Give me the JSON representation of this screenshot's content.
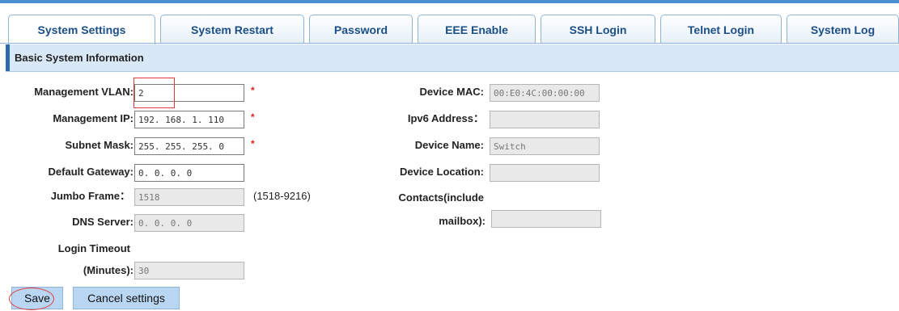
{
  "tabs": [
    {
      "label": "System Settings"
    },
    {
      "label": "System Restart"
    },
    {
      "label": "Password"
    },
    {
      "label": "EEE Enable"
    },
    {
      "label": "SSH Login"
    },
    {
      "label": "Telnet Login"
    },
    {
      "label": "System Log"
    }
  ],
  "section": {
    "title": "Basic System Information"
  },
  "left_fields": {
    "mgmt_vlan": {
      "label": "Management VLAN:",
      "value": "2",
      "required": "*"
    },
    "mgmt_ip": {
      "label": "Management IP:",
      "value": "192. 168. 1. 110",
      "required": "*"
    },
    "subnet": {
      "label": "Subnet Mask:",
      "value": "255. 255. 255. 0",
      "required": "*"
    },
    "gateway": {
      "label": "Default Gateway:",
      "value": "0. 0. 0. 0"
    },
    "jumbo": {
      "label": "Jumbo Frame：",
      "value": "1518",
      "range": "(1518-9216)"
    },
    "dns": {
      "label": "DNS Server:",
      "value": "0. 0. 0. 0"
    },
    "timeout": {
      "label_line1": "Login Timeout",
      "label_line2": "(Minutes):",
      "value": "30"
    }
  },
  "right_fields": {
    "mac": {
      "label": "Device MAC:",
      "value": "00:E0:4C:00:00:00"
    },
    "ipv6": {
      "label": "Ipv6 Address：",
      "value": ""
    },
    "name": {
      "label": "Device Name:",
      "value": "Switch"
    },
    "location": {
      "label": "Device Location:",
      "value": ""
    },
    "contacts": {
      "label_line1": "Contacts(include",
      "label_line2": "mailbox):",
      "value": ""
    }
  },
  "buttons": {
    "save": "Save",
    "cancel": "Cancel settings"
  },
  "colors": {
    "tab_text": "#1b4f86",
    "section_bg": "#d9e8f6",
    "button_bg": "#b9d6f2",
    "required": "#e02020",
    "highlight": "#e03b3b"
  }
}
